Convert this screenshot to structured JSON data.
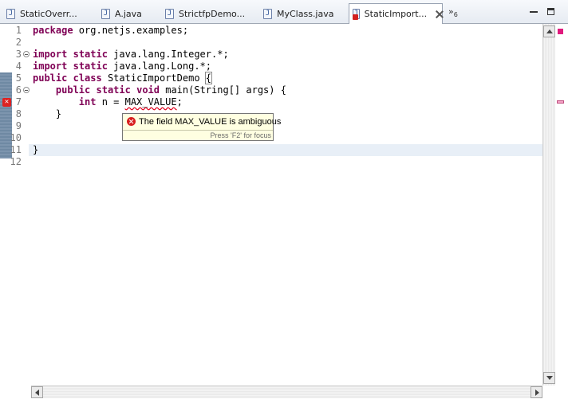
{
  "tabs": [
    {
      "label": "StaticOverr...",
      "icon": "java-file-icon"
    },
    {
      "label": "A.java",
      "icon": "java-file-icon"
    },
    {
      "label": "StrictfpDemo...",
      "icon": "java-file-icon"
    },
    {
      "label": "MyClass.java",
      "icon": "java-file-icon"
    },
    {
      "label": "StaticImport...",
      "icon": "java-file-error-icon",
      "active": true
    }
  ],
  "overflow": {
    "symbol": "»",
    "count": "6"
  },
  "code_lines": [
    {
      "num": "1",
      "text": "package org.netjs.examples;"
    },
    {
      "num": "2",
      "text": ""
    },
    {
      "num": "3",
      "text": "import static java.lang.Integer.*;"
    },
    {
      "num": "4",
      "text": "import static java.lang.Long.*;"
    },
    {
      "num": "5",
      "text": "public class StaticImportDemo {"
    },
    {
      "num": "6",
      "text": "    public static void main(String[] args) {"
    },
    {
      "num": "7",
      "text": "        int n = MAX_VALUE;"
    },
    {
      "num": "8",
      "text": "    }"
    },
    {
      "num": "9",
      "text": ""
    },
    {
      "num": "10",
      "text": ""
    },
    {
      "num": "11",
      "text": "}"
    },
    {
      "num": "12",
      "text": ""
    }
  ],
  "tooltip": {
    "message": "The field MAX_VALUE is ambiguous",
    "hint": "Press 'F2' for focus"
  },
  "colors": {
    "keyword": "#7f0055",
    "error": "#d21f1f",
    "tooltip_bg": "#ffffe1",
    "current_line": "#e8eff7"
  }
}
